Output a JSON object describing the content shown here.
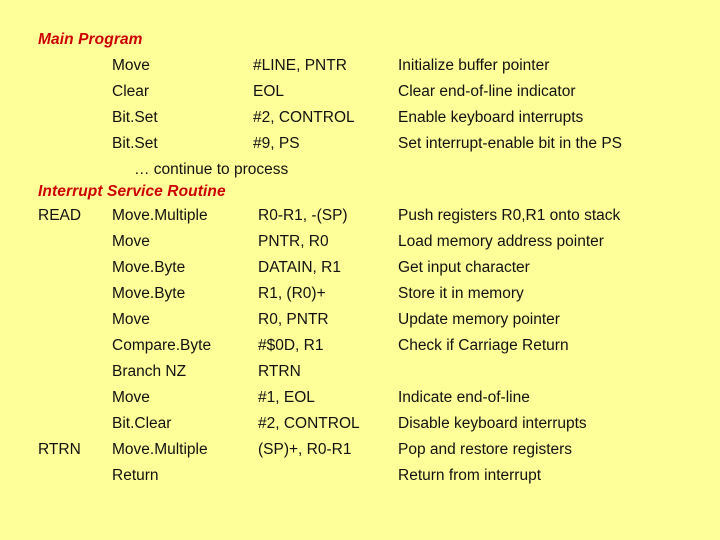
{
  "slide": {
    "background_color": "#ffff99",
    "heading_color": "#cc0000",
    "body_color": "#111111"
  },
  "sections": {
    "main": {
      "heading": "Main Program",
      "rows": [
        {
          "label": "",
          "mnemonic": "Move",
          "operand": "#LINE, PNTR",
          "comment": "Initialize buffer pointer"
        },
        {
          "label": "",
          "mnemonic": "Clear",
          "operand": "EOL",
          "comment": "Clear end-of-line indicator"
        },
        {
          "label": "",
          "mnemonic": "Bit.Set",
          "operand": "#2, CONTROL",
          "comment": "Enable keyboard interrupts"
        },
        {
          "label": "",
          "mnemonic": "Bit.Set",
          "operand": "#9, PS",
          "comment": "Set interrupt-enable bit in the PS"
        }
      ],
      "note": "… continue to process"
    },
    "isr": {
      "heading": "Interrupt Service Routine",
      "rows": [
        {
          "label": "READ",
          "mnemonic": "Move.Multiple",
          "operand": "R0-R1,  -(SP)",
          "comment": "Push registers R0,R1 onto stack"
        },
        {
          "label": "",
          "mnemonic": "Move",
          "operand": "PNTR, R0",
          "comment": "Load memory address pointer"
        },
        {
          "label": "",
          "mnemonic": "Move.Byte",
          "operand": "DATAIN, R1",
          "comment": "Get input character"
        },
        {
          "label": "",
          "mnemonic": "Move.Byte",
          "operand": "R1, (R0)+",
          "comment": "Store it in memory"
        },
        {
          "label": "",
          "mnemonic": "Move",
          "operand": "R0, PNTR",
          "comment": "Update memory pointer"
        },
        {
          "label": "",
          "mnemonic": "Compare.Byte",
          "operand": "#$0D, R1",
          "comment": "Check if Carriage Return"
        },
        {
          "label": "",
          "mnemonic": "Branch NZ",
          "operand": "RTRN",
          "comment": ""
        },
        {
          "label": "",
          "mnemonic": "Move",
          "operand": "#1, EOL",
          "comment": "Indicate end-of-line"
        },
        {
          "label": "",
          "mnemonic": "Bit.Clear",
          "operand": "#2, CONTROL",
          "comment": "Disable keyboard interrupts"
        },
        {
          "label": "RTRN",
          "mnemonic": "Move.Multiple",
          "operand": "(SP)+, R0-R1",
          "comment": "Pop and restore registers"
        },
        {
          "label": "",
          "mnemonic": "Return",
          "operand": "",
          "comment": "Return from interrupt"
        }
      ]
    }
  }
}
